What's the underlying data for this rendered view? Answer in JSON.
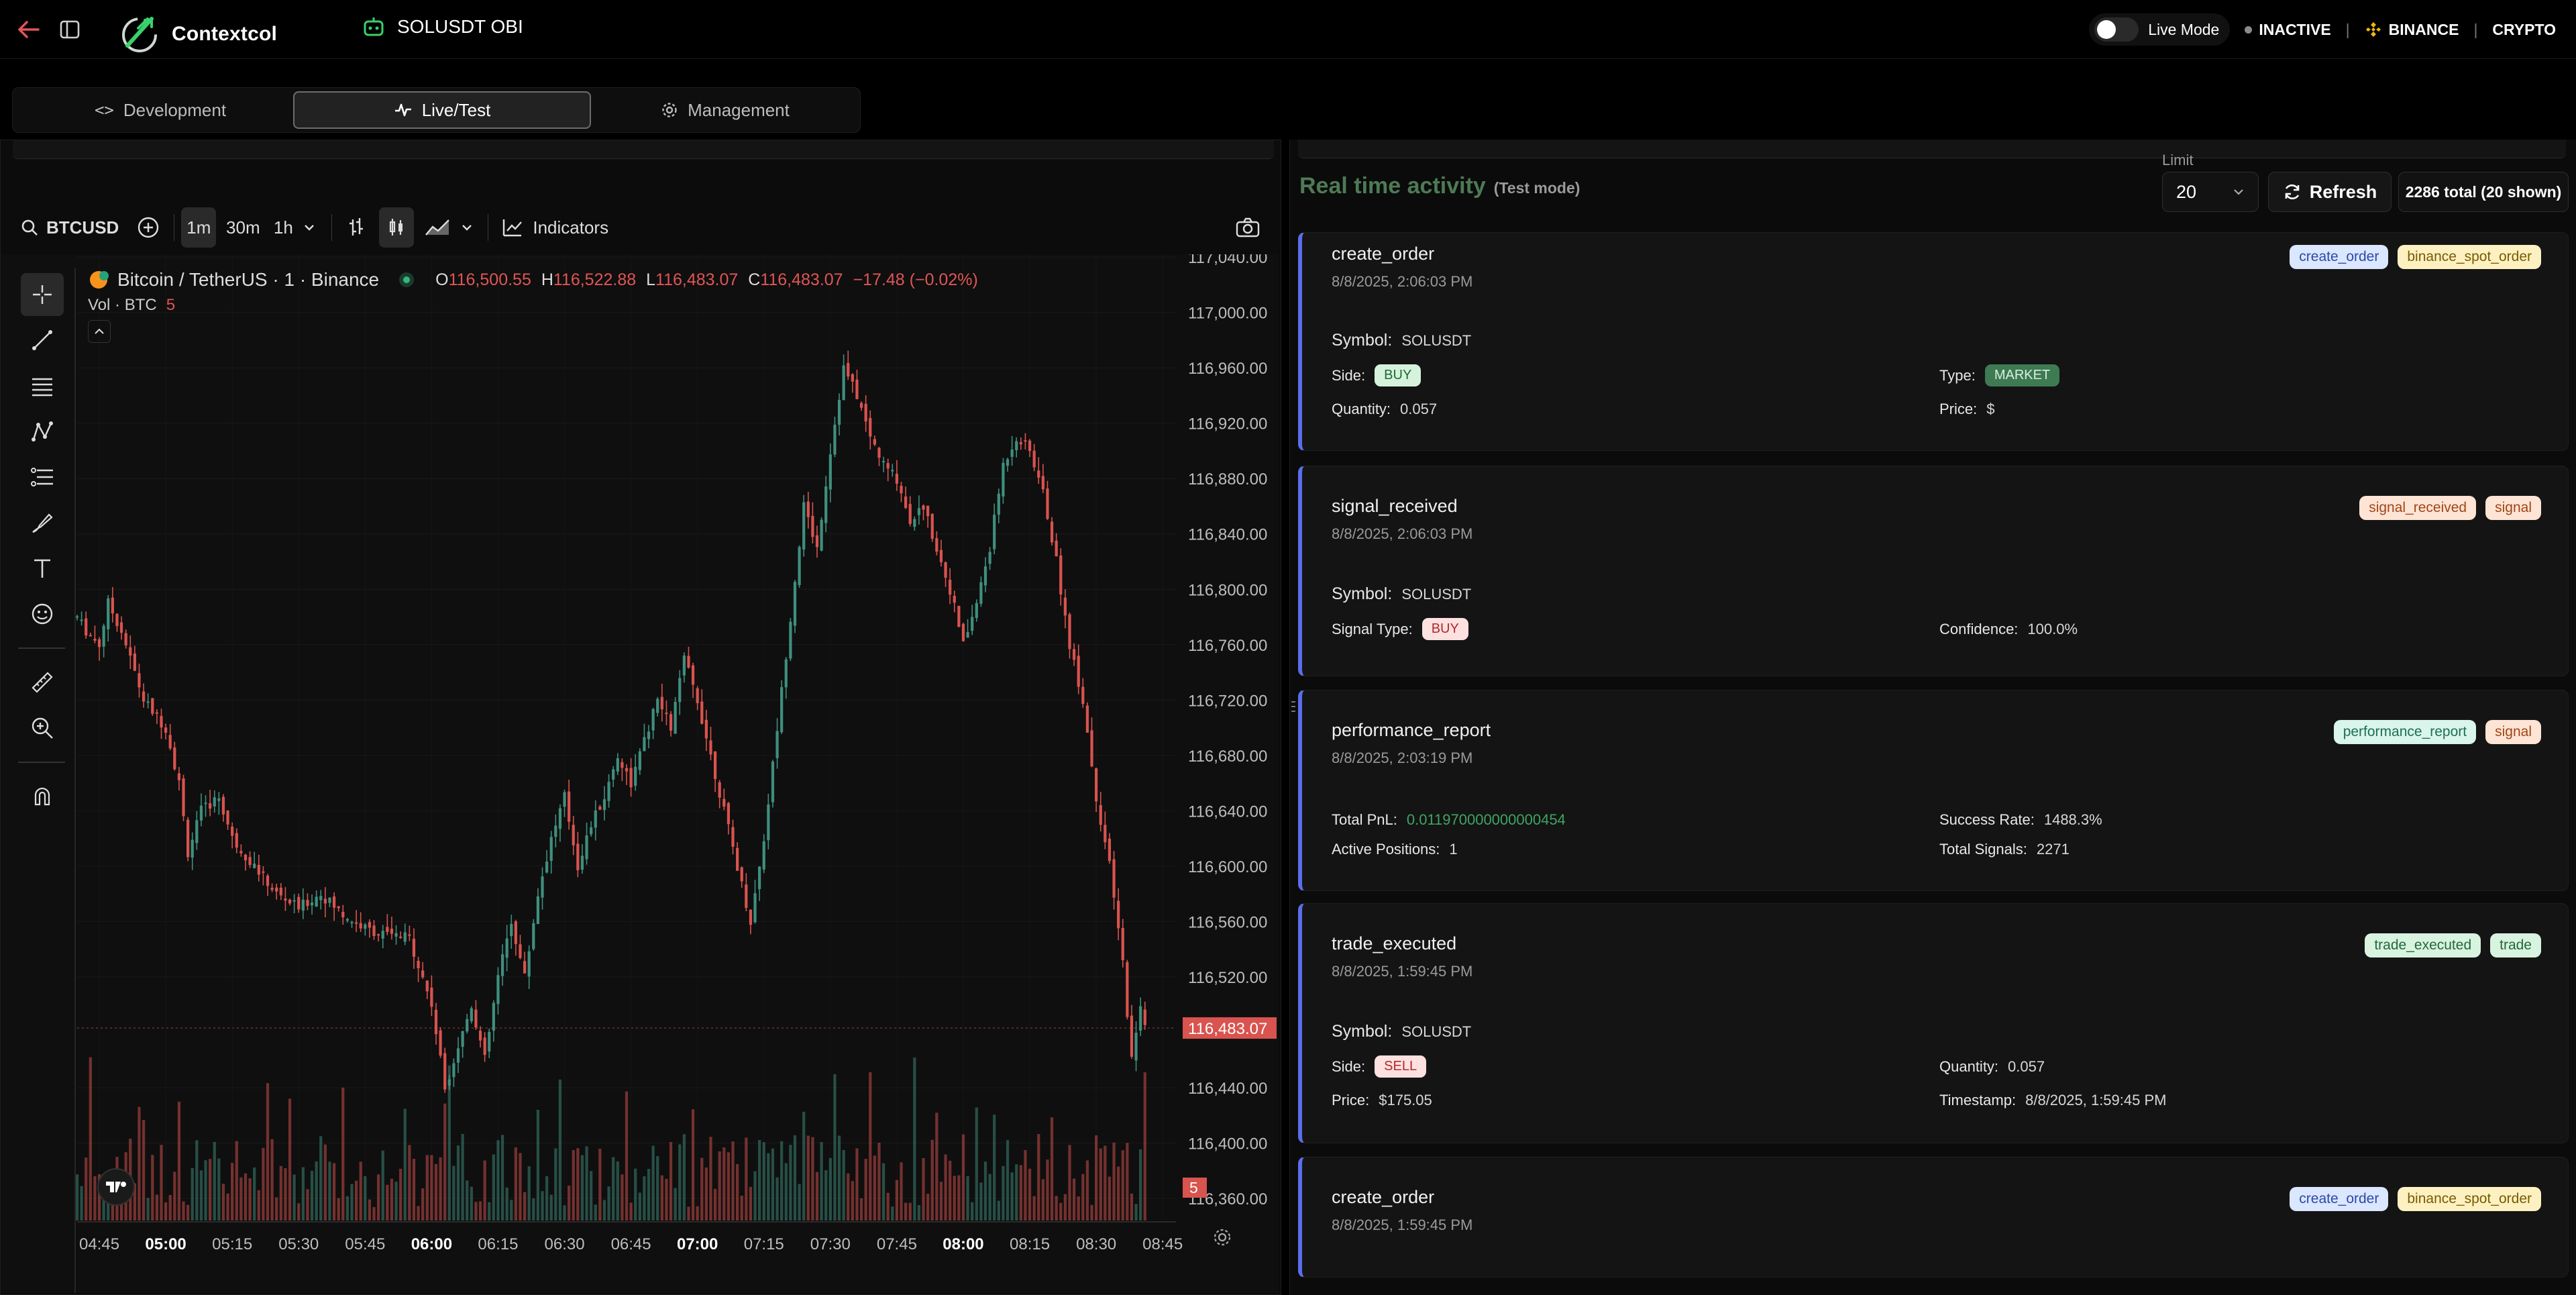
{
  "app": {
    "name": "Contextcol",
    "bot_name": "SOLUSDT OBI"
  },
  "header": {
    "live_mode_label": "Live Mode",
    "status": "INACTIVE",
    "exchange": "BINANCE",
    "market": "CRYPTO",
    "sep": "|"
  },
  "tabs": [
    {
      "label": "Development",
      "active": false
    },
    {
      "label": "Live/Test",
      "active": true
    },
    {
      "label": "Management",
      "active": false
    }
  ],
  "chart_toolbar": {
    "symbol": "BTCUSD",
    "intervals": [
      "1m",
      "30m",
      "1h"
    ],
    "indicators_label": "Indicators"
  },
  "chart_data": {
    "type": "candlestick",
    "title": "Bitcoin / TetherUS · 1 · Binance",
    "ohlc_legend": {
      "o_label": "O",
      "o": "116,500.55",
      "h_label": "H",
      "h": "116,522.88",
      "l_label": "L",
      "l": "116,483.07",
      "c_label": "C",
      "c": "116,483.07",
      "change": "−17.48 (−0.02%)"
    },
    "volume_legend": {
      "label": "Vol · BTC",
      "value": "5"
    },
    "y_ticks": [
      "117,040.00",
      "117,000.00",
      "116,960.00",
      "116,920.00",
      "116,880.00",
      "116,840.00",
      "116,800.00",
      "116,760.00",
      "116,720.00",
      "116,680.00",
      "116,640.00",
      "116,600.00",
      "116,560.00",
      "116,520.00",
      "116,483.07",
      "116,440.00",
      "116,400.00",
      "116,360.00"
    ],
    "y_tick_values": [
      117040,
      117000,
      116960,
      116920,
      116880,
      116840,
      116800,
      116760,
      116720,
      116680,
      116640,
      116600,
      116560,
      116520,
      116483.07,
      116440,
      116400,
      116360
    ],
    "ylim": [
      116344,
      117042
    ],
    "current_price": "116,483.07",
    "volume_badge": "5",
    "x_ticks": [
      "04:45",
      "05:00",
      "05:15",
      "05:30",
      "05:45",
      "06:00",
      "06:15",
      "06:30",
      "06:45",
      "07:00",
      "07:15",
      "07:30",
      "07:45",
      "08:00",
      "08:15",
      "08:30",
      "08:45"
    ],
    "x_ticks_bold": [
      "05:00",
      "06:00",
      "07:00",
      "08:00"
    ],
    "close_path": [
      [
        "04:40",
        116780
      ],
      [
        "04:42",
        116770
      ],
      [
        "04:45",
        116760
      ],
      [
        "04:47",
        116790
      ],
      [
        "04:50",
        116770
      ],
      [
        "04:55",
        116720
      ],
      [
        "05:00",
        116700
      ],
      [
        "05:03",
        116660
      ],
      [
        "05:05",
        116610
      ],
      [
        "05:08",
        116640
      ],
      [
        "05:12",
        116650
      ],
      [
        "05:15",
        116620
      ],
      [
        "05:20",
        116600
      ],
      [
        "05:25",
        116580
      ],
      [
        "05:30",
        116570
      ],
      [
        "05:35",
        116580
      ],
      [
        "05:40",
        116565
      ],
      [
        "05:45",
        116555
      ],
      [
        "05:50",
        116550
      ],
      [
        "05:55",
        116548
      ],
      [
        "06:00",
        116500
      ],
      [
        "06:03",
        116440
      ],
      [
        "06:06",
        116470
      ],
      [
        "06:09",
        116500
      ],
      [
        "06:12",
        116460
      ],
      [
        "06:15",
        116520
      ],
      [
        "06:18",
        116560
      ],
      [
        "06:21",
        116520
      ],
      [
        "06:24",
        116580
      ],
      [
        "06:27",
        116620
      ],
      [
        "06:30",
        116650
      ],
      [
        "06:33",
        116600
      ],
      [
        "06:36",
        116630
      ],
      [
        "06:39",
        116650
      ],
      [
        "06:42",
        116680
      ],
      [
        "06:45",
        116660
      ],
      [
        "06:48",
        116690
      ],
      [
        "06:51",
        116720
      ],
      [
        "06:54",
        116700
      ],
      [
        "06:57",
        116750
      ],
      [
        "07:00",
        116720
      ],
      [
        "07:03",
        116680
      ],
      [
        "07:06",
        116640
      ],
      [
        "07:09",
        116600
      ],
      [
        "07:12",
        116560
      ],
      [
        "07:15",
        116620
      ],
      [
        "07:18",
        116700
      ],
      [
        "07:21",
        116780
      ],
      [
        "07:24",
        116860
      ],
      [
        "07:27",
        116830
      ],
      [
        "07:30",
        116900
      ],
      [
        "07:33",
        116960
      ],
      [
        "07:36",
        116940
      ],
      [
        "07:39",
        116910
      ],
      [
        "07:42",
        116890
      ],
      [
        "07:45",
        116880
      ],
      [
        "07:48",
        116850
      ],
      [
        "07:51",
        116860
      ],
      [
        "07:54",
        116830
      ],
      [
        "07:57",
        116800
      ],
      [
        "08:00",
        116760
      ],
      [
        "08:03",
        116790
      ],
      [
        "08:06",
        116830
      ],
      [
        "08:09",
        116890
      ],
      [
        "08:12",
        116910
      ],
      [
        "08:15",
        116900
      ],
      [
        "08:18",
        116870
      ],
      [
        "08:21",
        116820
      ],
      [
        "08:24",
        116760
      ],
      [
        "08:27",
        116720
      ],
      [
        "08:30",
        116650
      ],
      [
        "08:33",
        116600
      ],
      [
        "08:36",
        116530
      ],
      [
        "08:38",
        116460
      ],
      [
        "08:40",
        116500
      ],
      [
        "08:41",
        116483
      ]
    ]
  },
  "activity": {
    "title": "Real time activity",
    "mode": "(Test mode)",
    "limit_label": "Limit",
    "limit_value": "20",
    "refresh_label": "Refresh",
    "total_text": "2286 total (20 shown)",
    "cards": [
      {
        "title": "create_order",
        "time": "8/8/2025, 2:06:03 PM",
        "badges": [
          {
            "text": "create_order",
            "bg": "#dbe6ff",
            "fg": "#2b4aa6"
          },
          {
            "text": "binance_spot_order",
            "bg": "#fdf1c2",
            "fg": "#7a5a00"
          }
        ],
        "symbol_label": "Symbol:",
        "symbol": "SOLUSDT",
        "side_label": "Side:",
        "side": "BUY",
        "type_label": "Type:",
        "type": "MARKET",
        "qty_label": "Quantity:",
        "qty": "0.057",
        "price_label": "Price:",
        "price": "$"
      },
      {
        "title": "signal_received",
        "time": "8/8/2025, 2:06:03 PM",
        "badges": [
          {
            "text": "signal_received",
            "bg": "#fde4d4",
            "fg": "#a04618"
          },
          {
            "text": "signal",
            "bg": "#fde4d4",
            "fg": "#a04618"
          }
        ],
        "symbol_label": "Symbol:",
        "symbol": "SOLUSDT",
        "sigtype_label": "Signal Type:",
        "sigtype": "BUY",
        "conf_label": "Confidence:",
        "conf": "100.0%"
      },
      {
        "title": "performance_report",
        "time": "8/8/2025, 2:03:19 PM",
        "badges": [
          {
            "text": "performance_report",
            "bg": "#d9f5ec",
            "fg": "#1f6e55"
          },
          {
            "text": "signal",
            "bg": "#fde4d4",
            "fg": "#a04618"
          }
        ],
        "pnl_label": "Total PnL:",
        "pnl": "0.011970000000000454",
        "rate_label": "Success Rate:",
        "rate": "1488.3%",
        "pos_label": "Active Positions:",
        "pos": "1",
        "sig_label": "Total Signals:",
        "sig": "2271"
      },
      {
        "title": "trade_executed",
        "time": "8/8/2025, 1:59:45 PM",
        "badges": [
          {
            "text": "trade_executed",
            "bg": "#d8f3df",
            "fg": "#22683a"
          },
          {
            "text": "trade",
            "bg": "#d8f3df",
            "fg": "#22683a"
          }
        ],
        "symbol_label": "Symbol:",
        "symbol": "SOLUSDT",
        "side_label": "Side:",
        "side": "SELL",
        "qty_label": "Quantity:",
        "qty": "0.057",
        "price_label": "Price:",
        "price": "$175.05",
        "ts_label": "Timestamp:",
        "ts": "8/8/2025, 1:59:45 PM"
      },
      {
        "title": "create_order",
        "time": "8/8/2025, 1:59:45 PM",
        "badges": [
          {
            "text": "create_order",
            "bg": "#dbe6ff",
            "fg": "#2b4aa6"
          },
          {
            "text": "binance_spot_order",
            "bg": "#fdf1c2",
            "fg": "#7a5a00"
          }
        ]
      }
    ]
  },
  "colors": {
    "up": "#3f8f7e",
    "down": "#d9534f",
    "accent": "#5b6eea",
    "buy_bg": "#d6f2dc",
    "buy_fg": "#1d6a32",
    "sell_bg": "#fde0e0",
    "sell_fg": "#b02a2a",
    "market_bg": "#3e7a52",
    "pnl": "#3fa463"
  }
}
